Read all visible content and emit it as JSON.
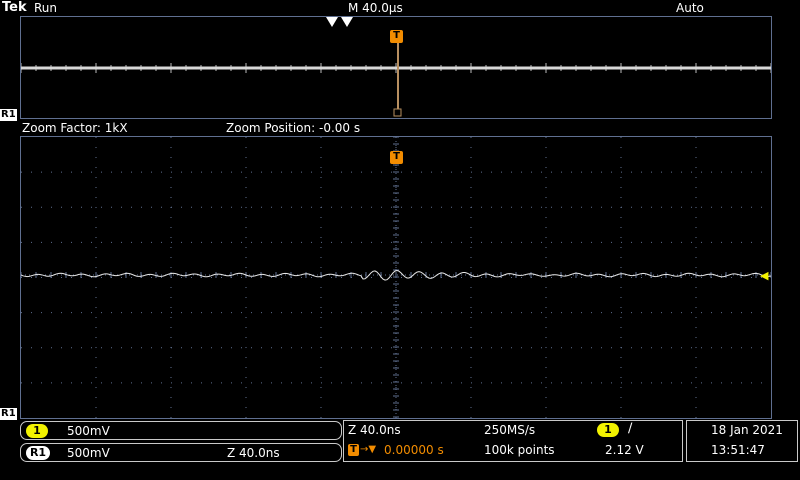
{
  "header": {
    "brand": "Tek",
    "run_state": "Run",
    "timebase": "M 40.0µs",
    "trigger_mode": "Auto"
  },
  "zoom": {
    "factor": "Zoom Factor: 1kX",
    "position": "Zoom Position: -0.00 s"
  },
  "markers": {
    "ref1": "R1",
    "trigger": "T",
    "ch1_level_arrow": "◀"
  },
  "status": {
    "ch1": {
      "badge": "1",
      "scale": "500mV"
    },
    "ref1": {
      "badge": "R1",
      "scale": "500mV",
      "zoom": "Z 40.0ns"
    },
    "acquisition": {
      "zoom_scale": "Z 40.0ns",
      "sample_rate": "250MS/s",
      "trigger_delay": "0.00000 s",
      "record_length": "100k points"
    },
    "trigger": {
      "source_badge": "1",
      "slope": "∕",
      "level": "2.12 V"
    },
    "datetime": {
      "date": "18 Jan  2021",
      "time": "13:51:47"
    }
  },
  "colors": {
    "ch1": "#f2f200",
    "trigger": "#f28c00",
    "grid": "#5f6f90",
    "trace": "#e8e8e8"
  }
}
